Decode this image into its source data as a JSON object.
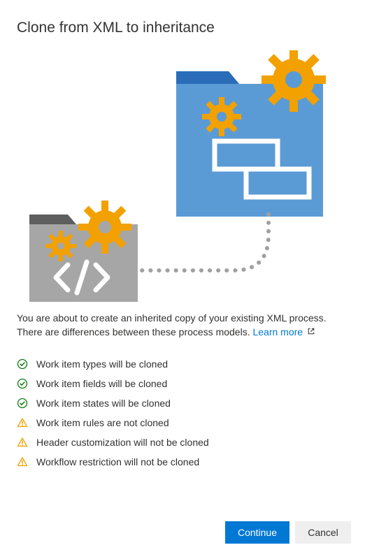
{
  "title": "Clone from XML to inheritance",
  "description_before": "You are about to create an inherited copy of your existing XML process. There are differences between these process models. ",
  "learn_more_label": "Learn more",
  "items": [
    {
      "status": "ok",
      "text": "Work item types will be cloned"
    },
    {
      "status": "ok",
      "text": "Work item fields will be cloned"
    },
    {
      "status": "ok",
      "text": "Work item states will be cloned"
    },
    {
      "status": "warn",
      "text": "Work item rules are not cloned"
    },
    {
      "status": "warn",
      "text": "Header customization will not be cloned"
    },
    {
      "status": "warn",
      "text": "Workflow restriction will not be cloned"
    }
  ],
  "buttons": {
    "continue": "Continue",
    "cancel": "Cancel"
  },
  "colors": {
    "primary": "#0078d4",
    "ok": "#0f7b0f",
    "warn": "#f2a100"
  }
}
